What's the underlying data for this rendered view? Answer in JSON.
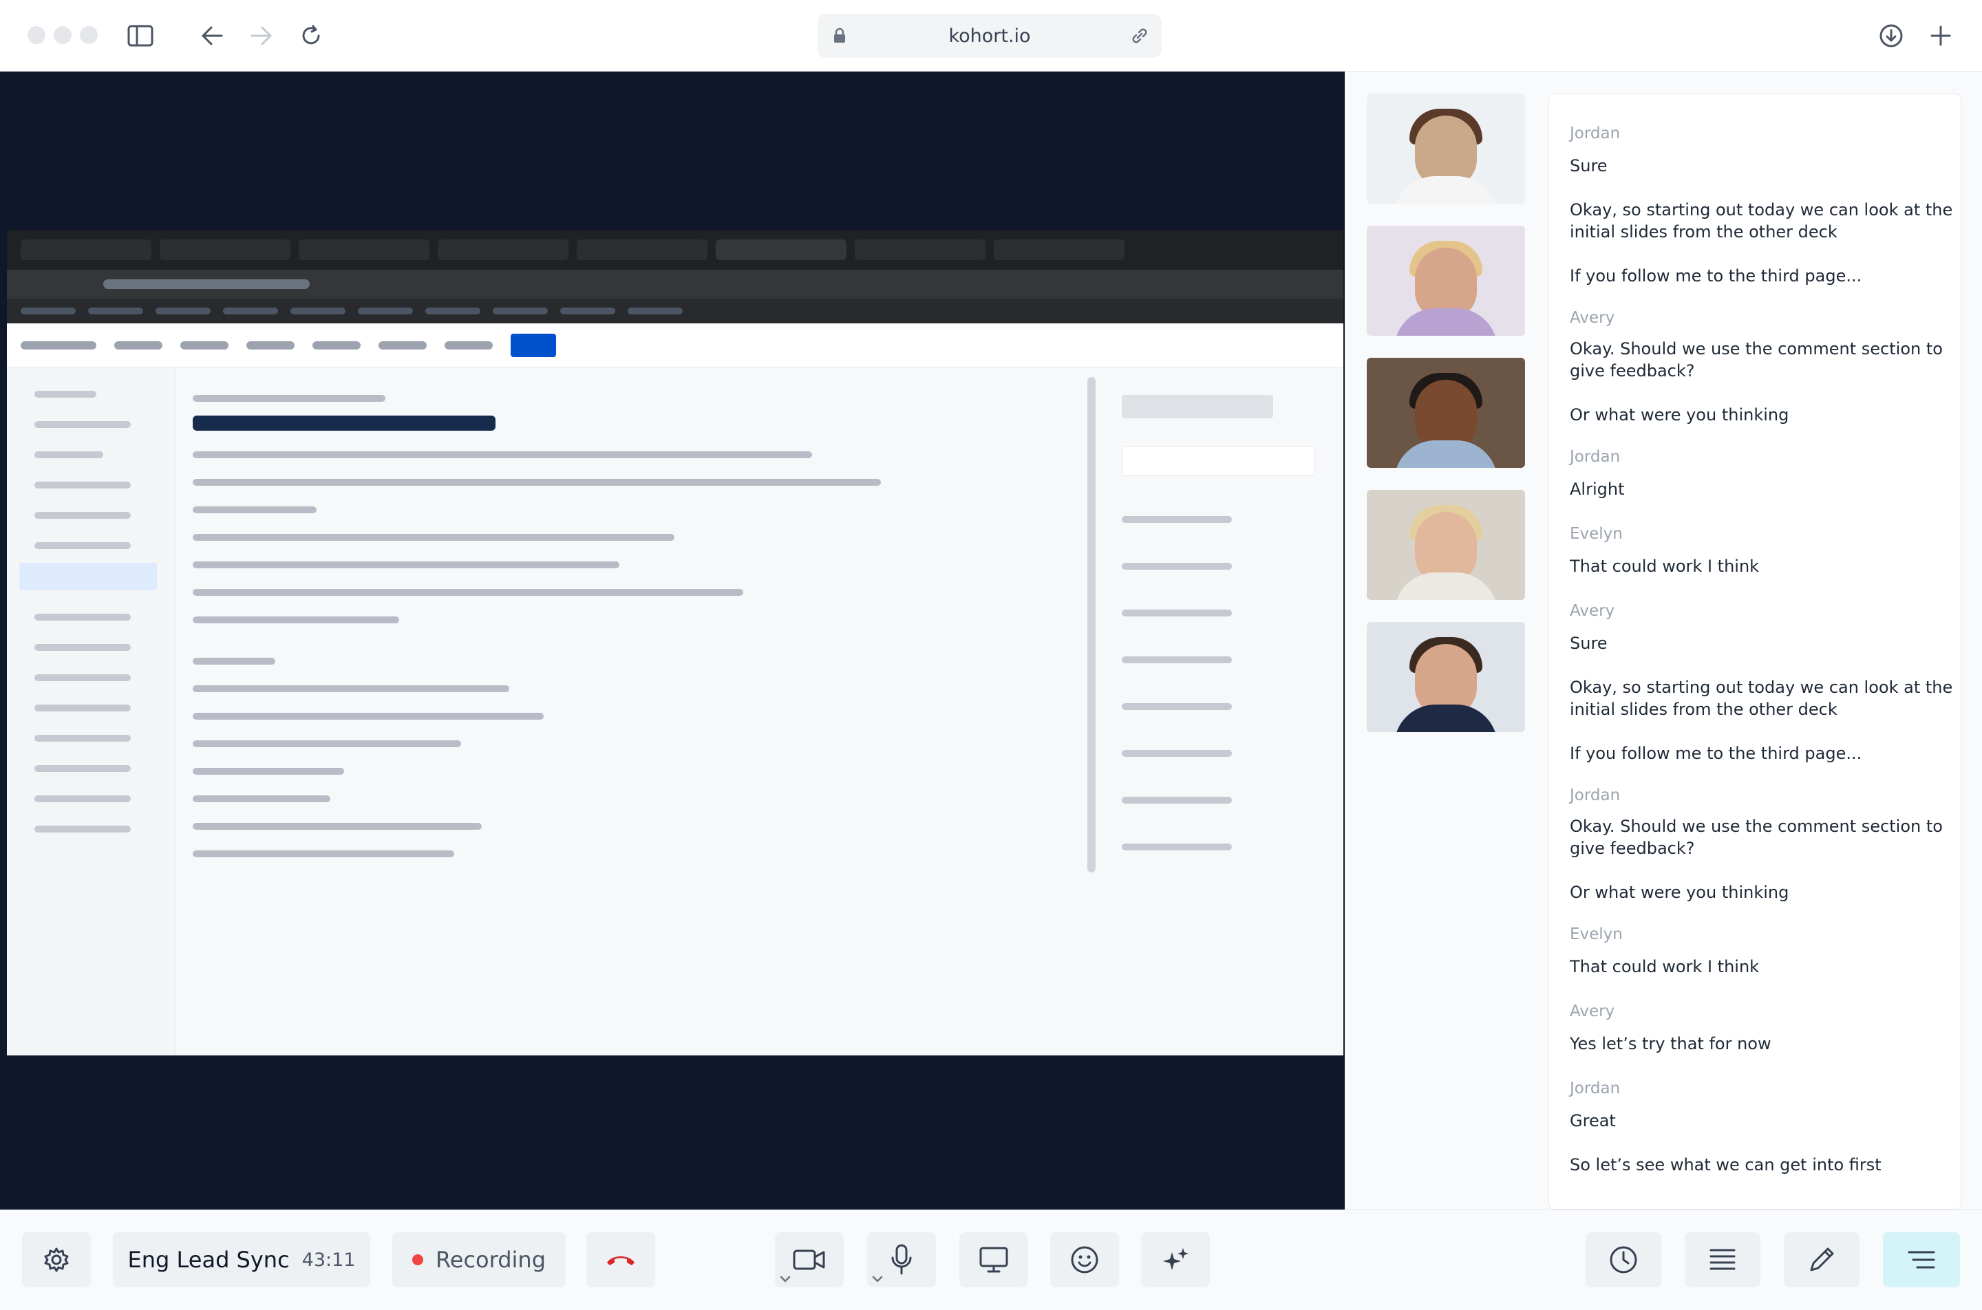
{
  "browser": {
    "url": "kohort.io"
  },
  "meeting": {
    "title": "Eng Lead Sync",
    "elapsed": "43:11",
    "recording_label": "Recording"
  },
  "participants": [
    {
      "icon": "participant-video",
      "color": "#c9a98a"
    },
    {
      "icon": "participant-video",
      "color": "#d6a58a"
    },
    {
      "icon": "participant-video",
      "color": "#7a4a30"
    },
    {
      "icon": "participant-video",
      "color": "#e2b89d"
    },
    {
      "icon": "participant-video",
      "color": "#d6a58a"
    }
  ],
  "transcript": [
    {
      "speaker": "Jordan",
      "lines": [
        "Sure",
        "Okay, so starting out today we can look at the initial slides from the other deck",
        "If you follow me to the third page..."
      ]
    },
    {
      "speaker": "Avery",
      "lines": [
        "Okay. Should we use the comment section to give feedback?",
        "Or what were you thinking"
      ]
    },
    {
      "speaker": "Jordan",
      "lines": [
        "Alright"
      ]
    },
    {
      "speaker": "Evelyn",
      "lines": [
        "That could work I think"
      ]
    },
    {
      "speaker": "Avery",
      "lines": [
        "Sure",
        "Okay, so starting out today we can look at the initial slides from the other deck",
        "If you follow me to the third page..."
      ]
    },
    {
      "speaker": "Jordan",
      "lines": [
        "Okay. Should we use the comment section to give feedback?",
        "Or what were you thinking"
      ]
    },
    {
      "speaker": "Evelyn",
      "lines": [
        "That could work I think"
      ]
    },
    {
      "speaker": "Avery",
      "lines": [
        "Yes let’s try that for now"
      ]
    },
    {
      "speaker": "Jordan",
      "lines": [
        "Great",
        "So let’s see what we can get into first"
      ]
    }
  ],
  "toolbar": {
    "icons": [
      "gear-icon",
      "hangup-icon",
      "camera-icon",
      "microphone-icon",
      "screen-share-icon",
      "emoji-icon",
      "sparkle-icon",
      "clock-icon",
      "list-icon",
      "pencil-icon",
      "menu-icon"
    ],
    "active_color": "#d4f4fa"
  }
}
